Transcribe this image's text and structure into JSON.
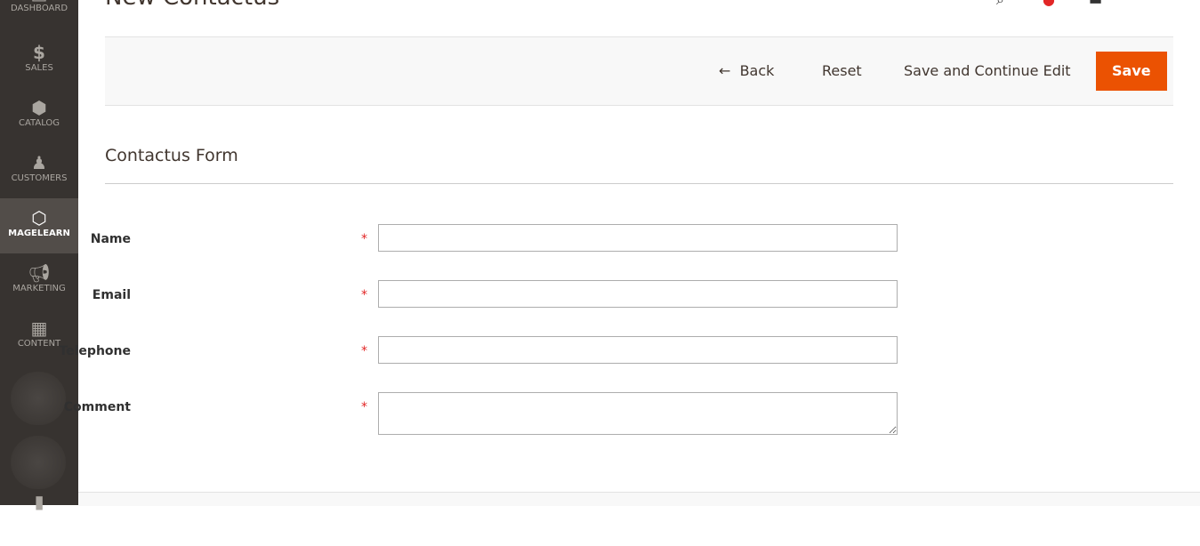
{
  "sidebar": {
    "items": [
      {
        "label": "DASHBOARD",
        "icon": "dashboard-icon"
      },
      {
        "label": "SALES",
        "icon": "dollar-icon"
      },
      {
        "label": "CATALOG",
        "icon": "box-icon"
      },
      {
        "label": "CUSTOMERS",
        "icon": "person-icon"
      },
      {
        "label": "MAGELEARN",
        "icon": "hexagon-icon",
        "active": true
      },
      {
        "label": "MARKETING",
        "icon": "megaphone-icon"
      },
      {
        "label": "CONTENT",
        "icon": "layout-icon"
      }
    ]
  },
  "header": {
    "title": "New Contactus"
  },
  "actions": {
    "back": "Back",
    "reset": "Reset",
    "save_continue": "Save and Continue Edit",
    "save": "Save"
  },
  "colors": {
    "accent": "#eb5202",
    "sidebar": "#373330",
    "required": "#e22626"
  },
  "form": {
    "title": "Contactus Form",
    "required_mark": "*",
    "fields": [
      {
        "label": "Name",
        "value": ""
      },
      {
        "label": "Email",
        "value": ""
      },
      {
        "label": "Telephone",
        "value": ""
      },
      {
        "label": "Comment",
        "value": ""
      }
    ]
  }
}
